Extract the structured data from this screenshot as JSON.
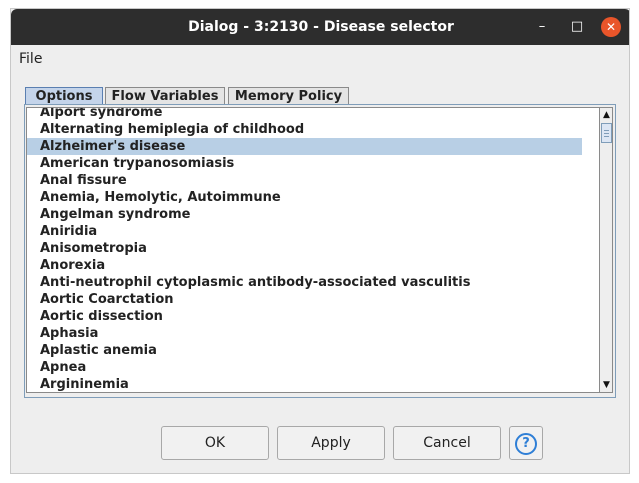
{
  "window": {
    "title": "Dialog - 3:2130 - Disease selector",
    "min_icon": "minimize-icon",
    "max_icon": "maximize-icon",
    "close_icon": "close-icon"
  },
  "menu": {
    "file": "File"
  },
  "tabs": [
    {
      "label": "Options",
      "active": true
    },
    {
      "label": "Flow Variables",
      "active": false
    },
    {
      "label": "Memory Policy",
      "active": false
    }
  ],
  "list": {
    "selected": "Alzheimer's disease",
    "items": [
      "Alport syndrome",
      "Alternating hemiplegia of childhood",
      "Alzheimer's disease",
      "American trypanosomiasis",
      "Anal fissure",
      "Anemia, Hemolytic, Autoimmune",
      "Angelman syndrome",
      "Aniridia",
      "Anisometropia",
      "Anorexia",
      "Anti-neutrophil cytoplasmic antibody-associated vasculitis",
      "Aortic Coarctation",
      "Aortic dissection",
      "Aphasia",
      "Aplastic anemia",
      "Apnea",
      "Argininemia"
    ]
  },
  "buttons": {
    "ok": "OK",
    "apply": "Apply",
    "cancel": "Cancel",
    "help": "?"
  },
  "colors": {
    "titlebar": "#2d2d2d",
    "close_button": "#e9552a",
    "selection": "#b8cfe5",
    "help_accent": "#2f7fd6"
  }
}
